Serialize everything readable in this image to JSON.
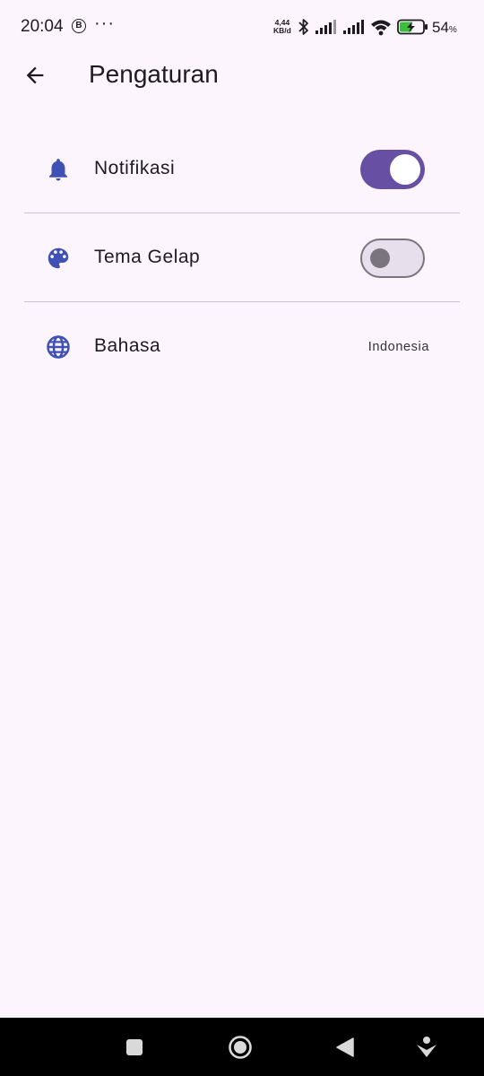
{
  "status_bar": {
    "time": "20:04",
    "notification_badge": "B",
    "more_dots": "···",
    "network_speed_value": "4,44",
    "network_speed_unit": "KB/d",
    "battery_percent": "54",
    "battery_percent_sign": "%",
    "battery_level": 0.54,
    "icons": [
      "bluetooth-icon",
      "signal-icon",
      "signal-icon",
      "wifi-icon",
      "battery-charging-icon"
    ]
  },
  "app_bar": {
    "title": "Pengaturan",
    "back_icon": "arrow-back-icon"
  },
  "settings": {
    "items": [
      {
        "label": "Notifikasi",
        "icon": "bell-icon",
        "type": "switch",
        "enabled": true
      },
      {
        "label": "Tema Gelap",
        "icon": "palette-icon",
        "type": "switch",
        "enabled": false
      },
      {
        "label": "Bahasa",
        "icon": "globe-icon",
        "type": "value",
        "value": "Indonesia"
      }
    ]
  },
  "nav_bar": {
    "buttons": [
      "recents-icon",
      "home-icon",
      "back-icon",
      "assistant-icon"
    ]
  },
  "colors": {
    "background": "#fcf5fd",
    "accent": "#6750a4",
    "icon": "#3f51b5",
    "divider": "#cac4d0",
    "switch_off_track": "#e7e0ec",
    "switch_off_outline": "#79747e"
  }
}
